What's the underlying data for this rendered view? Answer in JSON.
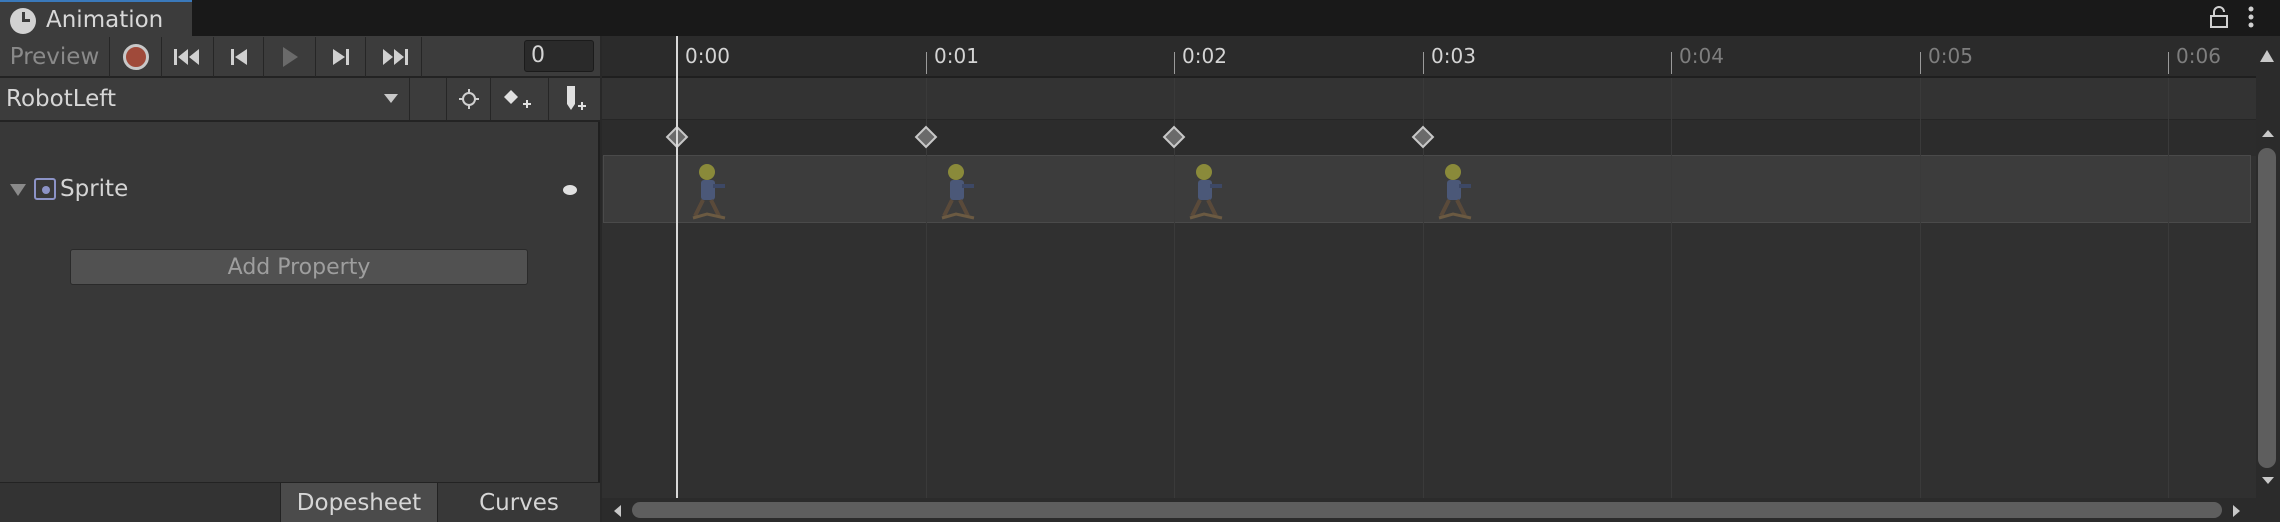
{
  "window": {
    "tab_title": "Animation"
  },
  "toolbar": {
    "preview_label": "Preview",
    "frame_value": "0"
  },
  "clip": {
    "name": "RobotLeft"
  },
  "properties": [
    {
      "label": "Sprite"
    }
  ],
  "add_property_label": "Add Property",
  "mode_tabs": {
    "dopesheet": "Dopesheet",
    "curves": "Curves"
  },
  "timeline": {
    "ticks": [
      "0:00",
      "0:01",
      "0:02",
      "0:03",
      "0:04",
      "0:05",
      "0:06"
    ],
    "keyframe_times": [
      "0:00",
      "0:01",
      "0:02",
      "0:03"
    ],
    "playhead_time": "0:00"
  },
  "colors": {
    "record": "#a04a3a",
    "tab_accent": "#3a79bb",
    "sprite_component": "#8c93c7"
  }
}
